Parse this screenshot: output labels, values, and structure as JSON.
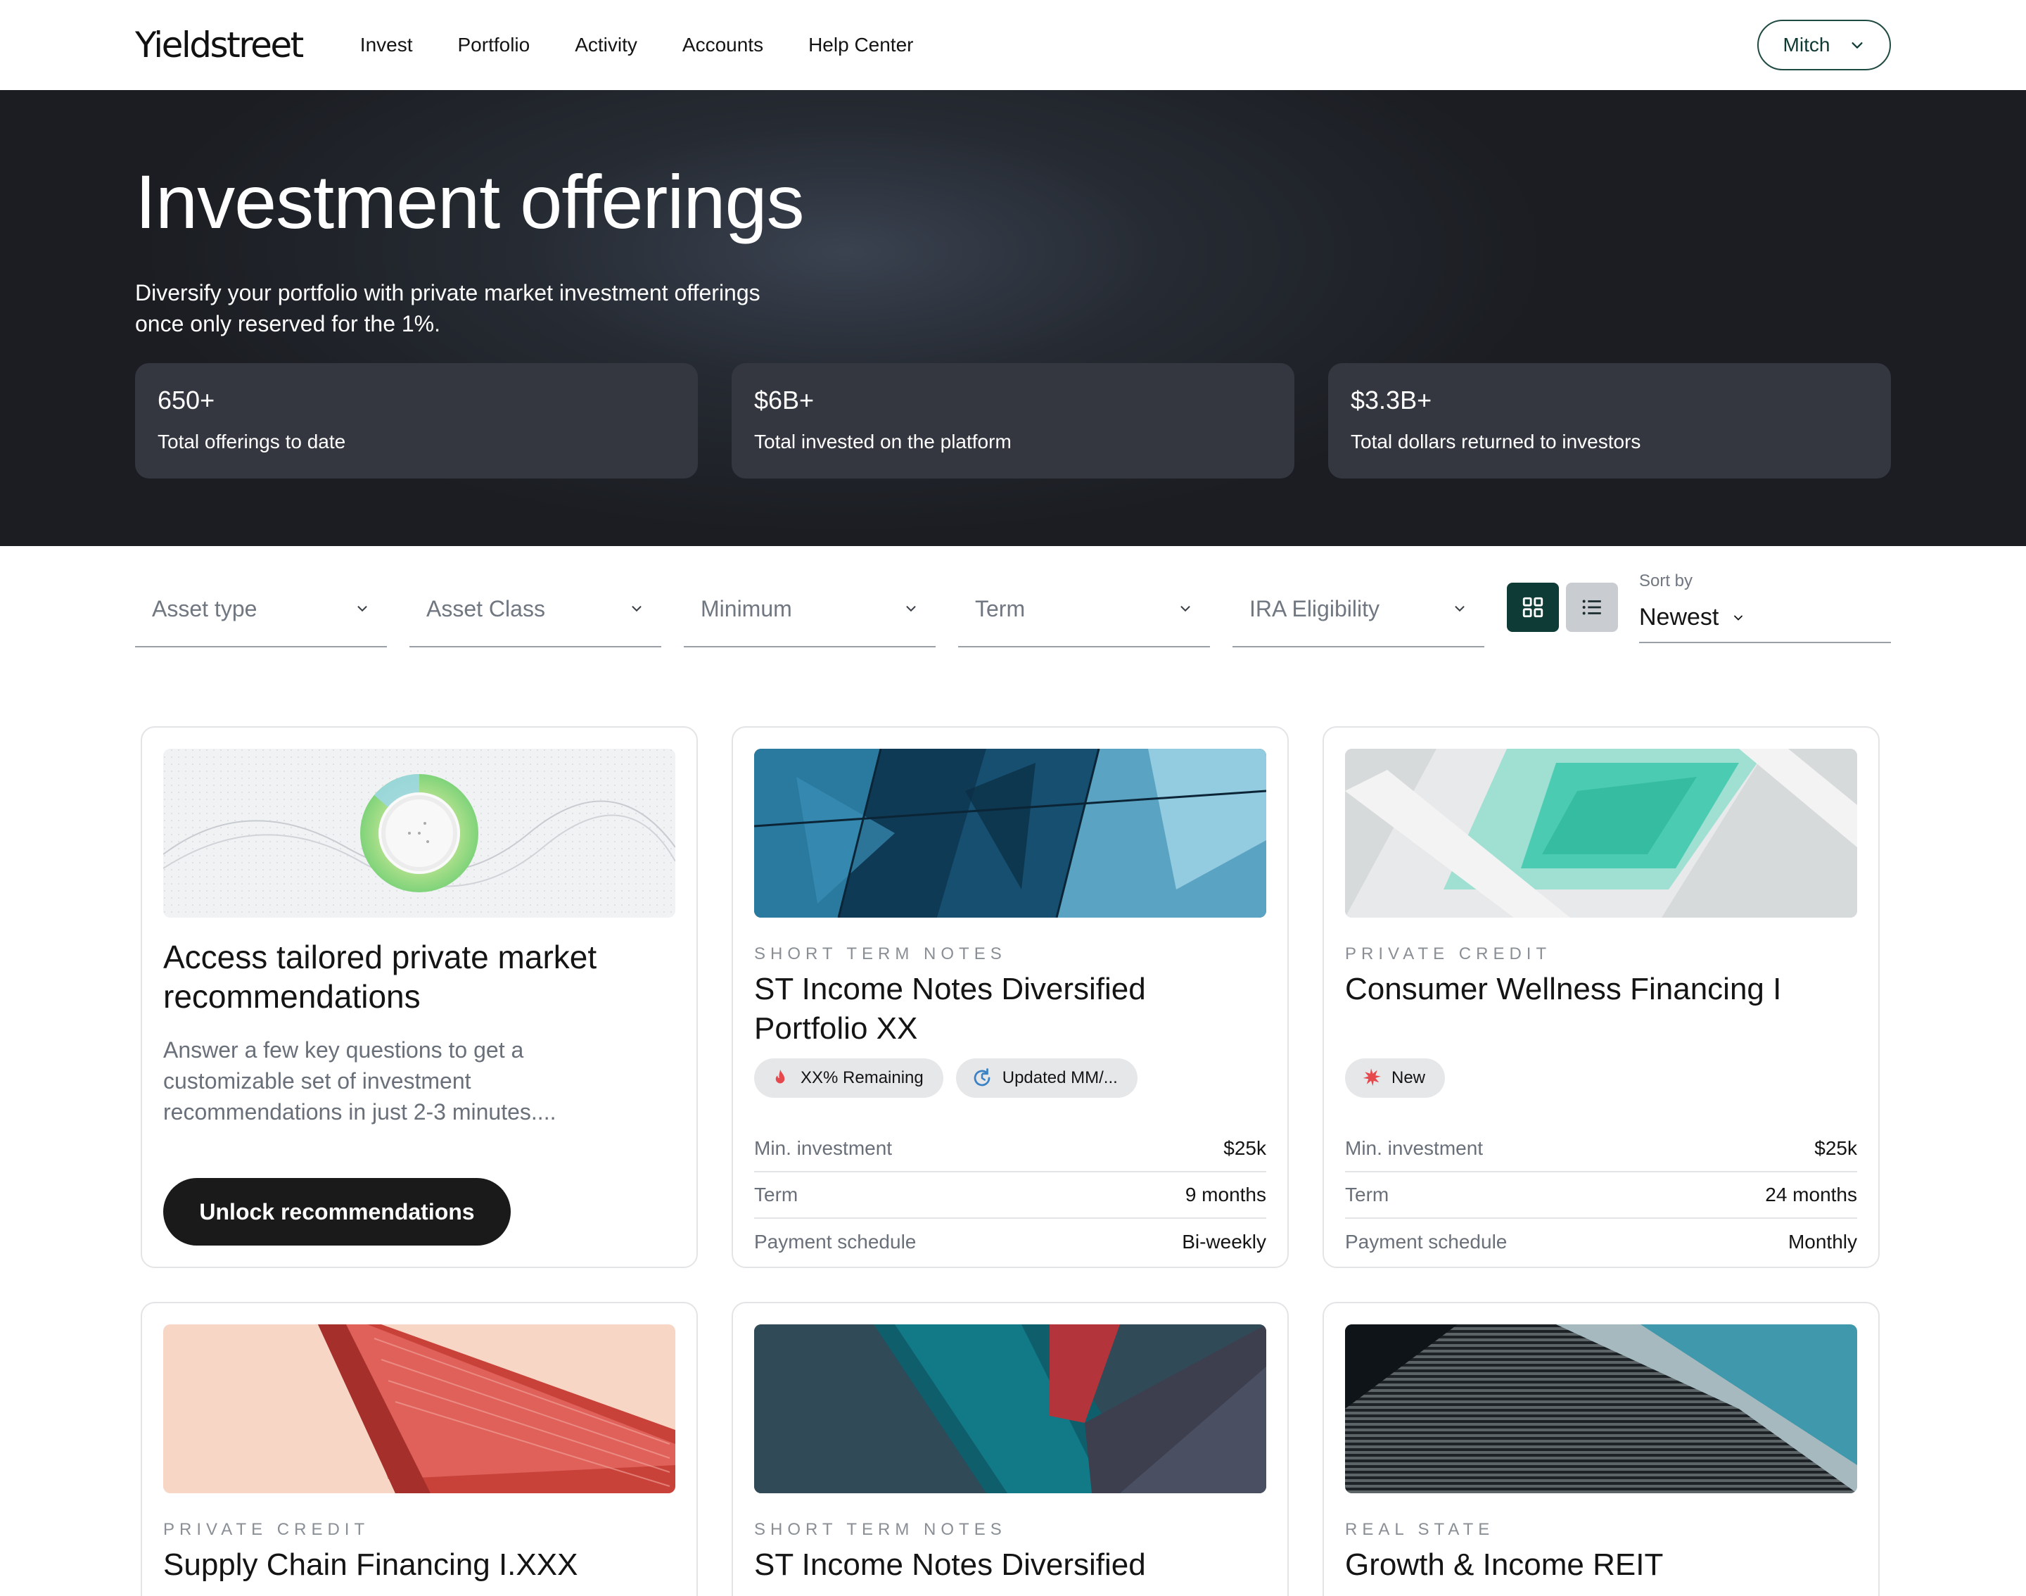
{
  "nav": {
    "logo": "Yieldstreet",
    "links": [
      "Invest",
      "Portfolio",
      "Activity",
      "Accounts",
      "Help Center"
    ],
    "user": "Mitch"
  },
  "hero": {
    "title": "Investment offerings",
    "subtitle": "Diversify your portfolio with private market investment offerings once only reserved for the 1%.",
    "stats": [
      {
        "value": "650+",
        "label": "Total offerings to date"
      },
      {
        "value": "$6B+",
        "label": "Total invested on the platform"
      },
      {
        "value": "$3.3B+",
        "label": "Total dollars returned to investors"
      }
    ]
  },
  "filters": {
    "items": [
      "Asset type",
      "Asset Class",
      "Minimum",
      "Term",
      "IRA Eligibility"
    ],
    "sort_caption": "Sort by",
    "sort_value": "Newest",
    "icons": {
      "grid": "grid-icon",
      "list": "list-icon",
      "chevron": "chevron-down-icon"
    }
  },
  "promo": {
    "title": "Access tailored private market recommendations",
    "body": "Answer a few key questions to get a customizable set of investment recommendations in just 2-3 minutes....",
    "button": "Unlock recommendations"
  },
  "offerings": [
    {
      "eyebrow": "SHORT TERM NOTES",
      "title": "ST Income Notes Diversified Portfolio XX",
      "chips": [
        {
          "icon": "flame-icon",
          "label": "XX% Remaining"
        },
        {
          "icon": "refresh-icon",
          "label": "Updated MM/..."
        }
      ],
      "rows": [
        {
          "label": "Min. investment",
          "value": "$25k"
        },
        {
          "label": "Term",
          "value": "9 months"
        },
        {
          "label": "Payment schedule",
          "value": "Bi-weekly"
        }
      ]
    },
    {
      "eyebrow": "PRIVATE CREDIT",
      "title": "Consumer Wellness Financing I",
      "chips": [
        {
          "icon": "starburst-icon",
          "label": "New"
        }
      ],
      "rows": [
        {
          "label": "Min. investment",
          "value": "$25k"
        },
        {
          "label": "Term",
          "value": "24 months"
        },
        {
          "label": "Payment schedule",
          "value": "Monthly"
        }
      ]
    },
    {
      "eyebrow": "PRIVATE CREDIT",
      "title": "Supply Chain Financing I.XXX"
    },
    {
      "eyebrow": "SHORT TERM NOTES",
      "title": "ST Income Notes Diversified"
    },
    {
      "eyebrow": "REAL STATE",
      "title": "Growth & Income REIT"
    }
  ],
  "colors": {
    "accent": "#0f3b36",
    "hero_bg": "#1b1d22",
    "stat_bg": "#343740",
    "button_dark": "#1a1a1a"
  }
}
